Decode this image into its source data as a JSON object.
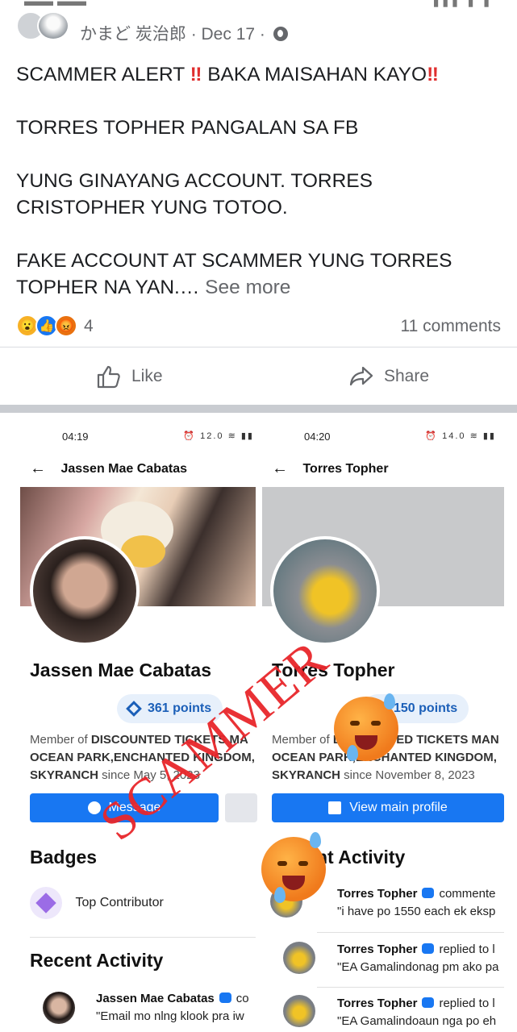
{
  "post": {
    "author": "かまど 炭治郎",
    "meta_date": "· Dec 17 ·",
    "body": {
      "line1_a": "SCAMMER ALERT ",
      "bang1": "‼",
      "line1_b": " BAKA MAISAHAN KAYO",
      "bang2": "‼",
      "line2": "TORRES TOPHER PANGALAN SA FB",
      "line3": "YUNG GINAYANG ACCOUNT. TORRES CRISTOPHER YUNG TOTOO.",
      "line4": "FAKE ACCOUNT AT SCAMMER YUNG TORRES TOPHER NA YAN.…",
      "see_more": " See more"
    },
    "reaction_count": "4",
    "comments": "11 comments",
    "like_label": "Like",
    "share_label": "Share"
  },
  "screenshot": {
    "left": {
      "time": "04:19",
      "status_icons": "⏰ 12.0 ≋ ▮▮",
      "title": "Jassen Mae Cabatas",
      "name": "Jassen Mae Cabatas",
      "points": "361 points",
      "member_prefix": "Member of ",
      "member_group_1": "DISCOUNTED TICKETS MA",
      "member_group_2": "OCEAN PARK,ENCHANTED KINGDOM,",
      "member_group_3": "SKYRANCH",
      "member_since": " since May 5, 2023",
      "button": "Message",
      "badges_heading": "Badges",
      "badge_label": "Top Contributor",
      "recent_heading": "Recent Activity",
      "activity_name": "Jassen Mae Cabatas",
      "activity_action": "co",
      "activity_quote": "\"Email mo nlng klook pra iw"
    },
    "right": {
      "time": "04:20",
      "status_icons": "⏰ 14.0 ≋ ▮▮",
      "title": "Torres Topher",
      "name": "Torres Topher",
      "points": "150 points",
      "member_prefix": "Member of ",
      "member_group_1": "DISCOUNTED TICKETS MAN",
      "member_group_2": "OCEAN PARK,ENCHANTED KINGDOM,",
      "member_group_3": "SKYRANCH",
      "member_since": " since November 8, 2023",
      "button": "View main profile",
      "recent_heading": "Recent Activity",
      "activities": [
        {
          "name": "Torres Topher",
          "action": "commente",
          "quote": "\"i have po 1550 each ek eksp"
        },
        {
          "name": "Torres Topher",
          "action": "replied to l",
          "quote": "\"EA Gamalindonag pm ako pa"
        },
        {
          "name": "Torres Topher",
          "action": "replied to l",
          "quote": "\"EA Gamalindoaun nga po eh"
        }
      ]
    },
    "overlay_text": "SCAMMER"
  },
  "colors": {
    "accent": "#1877f2",
    "scammer_red": "#e8262b",
    "muted": "#65676b"
  }
}
